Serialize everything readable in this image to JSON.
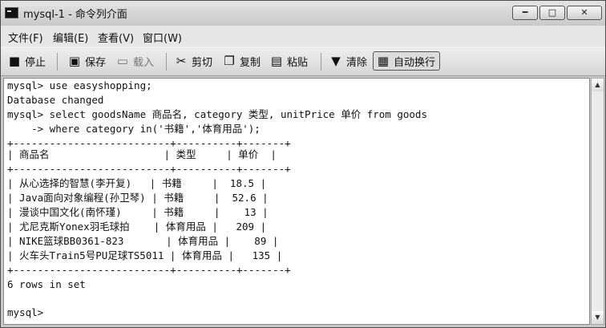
{
  "window": {
    "title": "mysql-1 - 命令列介面",
    "btn_min": "━",
    "btn_max": "□",
    "btn_close": "✕"
  },
  "menu": [
    "文件(F)",
    "编辑(E)",
    "查看(V)",
    "窗口(W)"
  ],
  "toolbar": {
    "stop": "停止",
    "save": "保存",
    "load": "载入",
    "cut": "剪切",
    "copy": "复制",
    "paste": "粘贴",
    "clear": "清除",
    "wrap": "自动换行"
  },
  "console_lines": [
    "mysql> use easyshopping;",
    "Database changed",
    "mysql> select goodsName 商品名, category 类型, unitPrice 单价 from goods",
    "    -> where category in('书籍','体育用品');",
    "+--------------------------+----------+-------+",
    "| 商品名                   | 类型     | 单价  |",
    "+--------------------------+----------+-------+",
    "| 从心选择的智慧(李开复)   | 书籍     |  18.5 |",
    "| Java面向对象编程(孙卫琴) | 书籍     |  52.6 |",
    "| 漫谈中国文化(南怀瑾)     | 书籍     |    13 |",
    "| 尤尼克斯Yonex羽毛球拍    | 体育用品 |   209 |",
    "| NIKE篮球BB0361-823       | 体育用品 |    89 |",
    "| 火车头Train5号PU足球TS5011 | 体育用品 |   135 |",
    "+--------------------------+----------+-------+",
    "6 rows in set",
    "",
    "mysql>"
  ]
}
